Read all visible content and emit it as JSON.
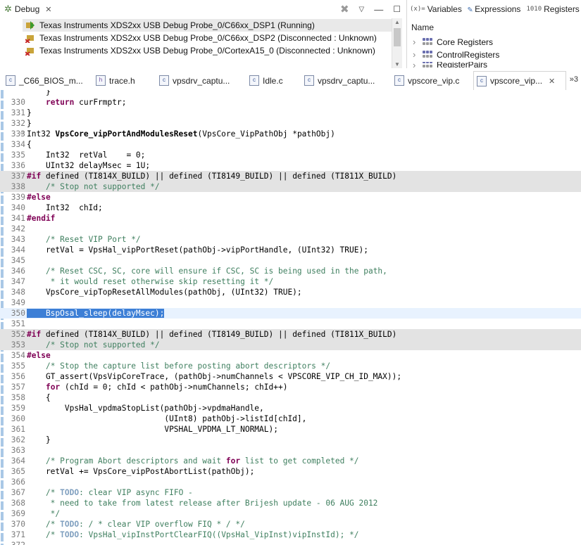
{
  "debug_view": {
    "tab_label": "Debug",
    "tree": [
      {
        "label": "Texas Instruments XDS2xx USB Debug Probe_0/C66xx_DSP1 (Running)",
        "state": "running"
      },
      {
        "label": "Texas Instruments XDS2xx USB Debug Probe_0/C66xx_DSP2 (Disconnected : Unknown)",
        "state": "disconnected"
      },
      {
        "label": "Texas Instruments XDS2xx USB Debug Probe_0/CortexA15_0 (Disconnected : Unknown)",
        "state": "disconnected"
      }
    ]
  },
  "variables_view": {
    "tabs": [
      {
        "icon_text": "(x)=",
        "label": "Variables"
      },
      {
        "icon_text": "",
        "label": "Expressions"
      },
      {
        "icon_text": "1010",
        "label": "Registers"
      }
    ],
    "column_header": "Name",
    "rows": [
      "Core Registers",
      "ControlRegisters",
      "RegisterPairs"
    ]
  },
  "editor_tabs": [
    {
      "label": "_C66_BIOS_m...",
      "type": "c"
    },
    {
      "label": "trace.h",
      "type": "h"
    },
    {
      "label": "vpsdrv_captu...",
      "type": "c"
    },
    {
      "label": "Idle.c",
      "type": "c"
    },
    {
      "label": "vpsdrv_captu...",
      "type": "c"
    },
    {
      "label": "vpscore_vip.c",
      "type": "c"
    },
    {
      "label": "vpscore_vip...",
      "type": "c",
      "active": true
    }
  ],
  "overflow_label": "»3",
  "code_lines": [
    {
      "n": "",
      "fold": "",
      "html": "    }",
      "text": "    }"
    },
    {
      "n": "330",
      "text": "    return curFrmptr;"
    },
    {
      "n": "331",
      "text": "}"
    },
    {
      "n": "332",
      "text": "}"
    },
    {
      "n": "333",
      "fold": "⊖",
      "text": "Int32 VpsCore_vipPortAndModulesReset(VpsCore_VipPathObj *pathObj)"
    },
    {
      "n": "334",
      "text": "{"
    },
    {
      "n": "335",
      "text": "    Int32  retVal    = 0;"
    },
    {
      "n": "336",
      "text": "    UInt32 delayMsec = 1U;"
    },
    {
      "n": "337",
      "text": "#if defined (TI814X_BUILD) || defined (TI8149_BUILD) || defined (TI811X_BUILD)",
      "inactive": true
    },
    {
      "n": "338",
      "text": "    /* Stop not supported */",
      "inactive": true
    },
    {
      "n": "339",
      "text": "#else"
    },
    {
      "n": "340",
      "text": "    Int32  chId;"
    },
    {
      "n": "341",
      "text": "#endif"
    },
    {
      "n": "342",
      "text": ""
    },
    {
      "n": "343",
      "text": "    /* Reset VIP Port */"
    },
    {
      "n": "344",
      "text": "    retVal = VpsHal_vipPortReset(pathObj->vipPortHandle, (UInt32) TRUE);"
    },
    {
      "n": "345",
      "text": ""
    },
    {
      "n": "346",
      "text": "    /* Reset CSC, SC, core will ensure if CSC, SC is being used in the path,"
    },
    {
      "n": "347",
      "text": "     * it would reset otherwise skip resetting it */"
    },
    {
      "n": "348",
      "text": "    VpsCore_vipTopResetAllModules(pathObj, (UInt32) TRUE);"
    },
    {
      "n": "349",
      "text": ""
    },
    {
      "n": "350",
      "text": "    BspOsal_sleep(delayMsec);",
      "current": true
    },
    {
      "n": "351",
      "text": ""
    },
    {
      "n": "352",
      "text": "#if defined (TI814X_BUILD) || defined (TI8149_BUILD) || defined (TI811X_BUILD)",
      "inactive": true
    },
    {
      "n": "353",
      "text": "    /* Stop not supported */",
      "inactive": true
    },
    {
      "n": "354",
      "text": "#else"
    },
    {
      "n": "355",
      "text": "    /* Stop the capture list before posting abort descriptors */"
    },
    {
      "n": "356",
      "text": "    GT_assert(VpsVipCoreTrace, (pathObj->numChannels < VPSCORE_VIP_CH_ID_MAX));"
    },
    {
      "n": "357",
      "text": "    for (chId = 0; chId < pathObj->numChannels; chId++)"
    },
    {
      "n": "358",
      "text": "    {"
    },
    {
      "n": "359",
      "text": "        VpsHal_vpdmaStopList(pathObj->vpdmaHandle,"
    },
    {
      "n": "360",
      "text": "                             (UInt8) pathObj->listId[chId],"
    },
    {
      "n": "361",
      "text": "                             VPSHAL_VPDMA_LT_NORMAL);"
    },
    {
      "n": "362",
      "text": "    }"
    },
    {
      "n": "363",
      "text": ""
    },
    {
      "n": "364",
      "text": "    /* Program Abort descriptors and wait for list to get completed */"
    },
    {
      "n": "365",
      "text": "    retVal += VpsCore_vipPostAbortList(pathObj);"
    },
    {
      "n": "366",
      "text": ""
    },
    {
      "n": "367",
      "text": "    /* TODO: clear VIP async FIFO -"
    },
    {
      "n": "368",
      "text": "     * need to take from latest release after Brijesh update - 06 AUG 2012"
    },
    {
      "n": "369",
      "text": "     */"
    },
    {
      "n": "370",
      "text": "    /* TODO: / * clear VIP overflow FIQ * / */"
    },
    {
      "n": "371",
      "text": "    /* TODO: VpsHal_vipInstPortClearFIQ((VpsHal_VipInst)vipInstId); */"
    },
    {
      "n": "372",
      "text": ""
    }
  ]
}
